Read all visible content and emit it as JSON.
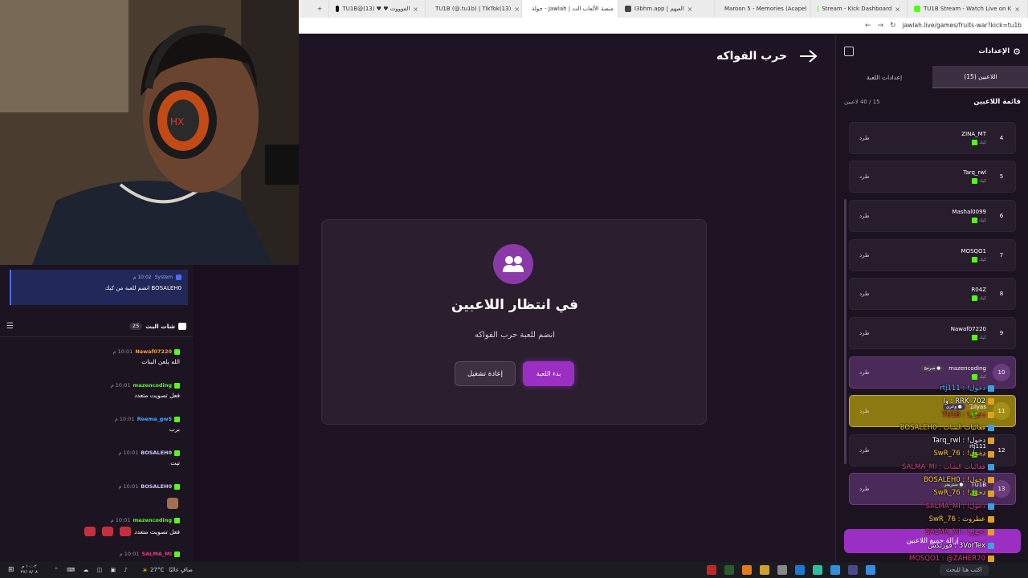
{
  "browser": {
    "tabs": [
      {
        "label": "TU1B Stream - Watch Live on K",
        "color": "#53fc18"
      },
      {
        "label": "Stream - Kick Dashboard",
        "color": "#53fc18"
      },
      {
        "label": "Maroon 5 - Memories (Acapel",
        "color": "#ff0000"
      },
      {
        "label": "l3bhm.app | العبهم",
        "color": "#444444"
      },
      {
        "label": "جولة - Jawlah | منصة الألعاب الت",
        "color": "#7a3ba0"
      },
      {
        "label": "TU1B (@.tu1b) | TikTok(13)",
        "color": "#111111"
      },
      {
        "label": "TU1B@(13) ♥ ♥ الفوووت",
        "color": "#111111"
      }
    ],
    "address": "jawlah.live/games/fruits-war?kick=tu1b"
  },
  "chat": {
    "pinned": {
      "user": "System",
      "time": "10:02 م",
      "text": "BOSALEH0 انضم للعبة من كيك"
    },
    "title": "شات البث",
    "count": "25",
    "messages": [
      {
        "user": "Nawaf07220",
        "color": "#f0a040",
        "time": "10:01 م",
        "text": "الله يلعن البنات"
      },
      {
        "user": "mazencoding",
        "color": "#53fc18",
        "time": "10:01 م",
        "text": "فعل تصويت متعدد"
      },
      {
        "user": "Reema_gw5",
        "color": "#4aa8ff",
        "time": "10:01 م",
        "text": "برب"
      },
      {
        "user": "BOSALEH0",
        "color": "#c8c8ff",
        "time": "10:01 م",
        "text": "تيت"
      },
      {
        "user": "BOSALEH0",
        "color": "#c8c8ff",
        "time": "10:01 م",
        "text": ""
      },
      {
        "user": "mazencoding",
        "color": "#53fc18",
        "time": "10:01 م",
        "text": "فعل تصويت متعدد"
      },
      {
        "user": "SALMA_MI",
        "color": "#e0407a",
        "time": "10:01 م",
        "text": ""
      }
    ]
  },
  "stage": {
    "title": "حرب الفواكه",
    "modal_title": "في انتظار اللاعبين",
    "modal_sub": "انضم للعبة حرب الفواكه",
    "start_label": "بدء اللعبة",
    "restart_label": "إعادة تشغيل"
  },
  "panel": {
    "title": "الإعدادات",
    "tab_players": "اللاعبين (15)",
    "tab_settings": "إعدادات اللعبة",
    "list_title": "قائمة اللاعبين",
    "list_count": "15 / 40 لاعبين",
    "kick_label": "طرد",
    "platform_label": "كيك",
    "clear_label": "إزالة جميع اللاعبين",
    "players": [
      {
        "num": "4",
        "name": "ZINA_MT",
        "badge": ""
      },
      {
        "num": "5",
        "name": "Tarq_rwl",
        "badge": ""
      },
      {
        "num": "6",
        "name": "Mashal0099",
        "badge": ""
      },
      {
        "num": "7",
        "name": "MOSQO1",
        "badge": ""
      },
      {
        "num": "8",
        "name": "R04Z",
        "badge": ""
      },
      {
        "num": "9",
        "name": "Nawaf07220",
        "badge": ""
      },
      {
        "num": "10",
        "name": "mazencoding",
        "badge": "● مبرمج"
      },
      {
        "num": "11",
        "name": "1ilyas",
        "badge": "● وعري"
      },
      {
        "num": "12",
        "name": "rtj111",
        "badge": ""
      },
      {
        "num": "13",
        "name": "TU1B",
        "badge": "● ستريمر"
      }
    ]
  },
  "overlay": {
    "lines": [
      {
        "text": "دخول! : rtj111",
        "color": "#53b8ff"
      },
      {
        "text": "RRK_702 : وا",
        "color": "#ffffff"
      },
      {
        "text": "دخول! : TU1B",
        "color": "#ff3030"
      },
      {
        "text": "فعاليات الشات : BOSALEH0",
        "color": "#ffd030"
      },
      {
        "text": "دخول! : Tarq_rwl",
        "color": "#ffffff"
      },
      {
        "text": "دخول! : SwR_76",
        "color": "#ffd030"
      },
      {
        "text": "فعاليات الشات : SALMA_MI",
        "color": "#e0407a"
      },
      {
        "text": "دخول! : BOSALEH0",
        "color": "#ffd030"
      },
      {
        "text": "دخول! : SwR_76",
        "color": "#ffd030"
      },
      {
        "text": "دخول! : SALMA_MI",
        "color": "#e0407a"
      },
      {
        "text": "عطروث : SwR_76",
        "color": "#ffd030"
      },
      {
        "text": "دخول! : SALMA_MI",
        "color": "#e0407a"
      },
      {
        "text": "3VorTex : فورتكس",
        "color": "#ffffff"
      },
      {
        "text": "MOSQO1 : @ZAHER70",
        "color": "#e0407a"
      }
    ]
  },
  "taskbar": {
    "weather": "27°C",
    "weather_label": "صافٍ غالبًا",
    "search_placeholder": "اكتب هنا للبحث",
    "time": "١٠:٠٢ م",
    "date": "٢٧/٠٥/٠٨"
  },
  "colors": {
    "accent": "#9b2fc4",
    "kick": "#53fc18",
    "bg": "#1f1423"
  }
}
